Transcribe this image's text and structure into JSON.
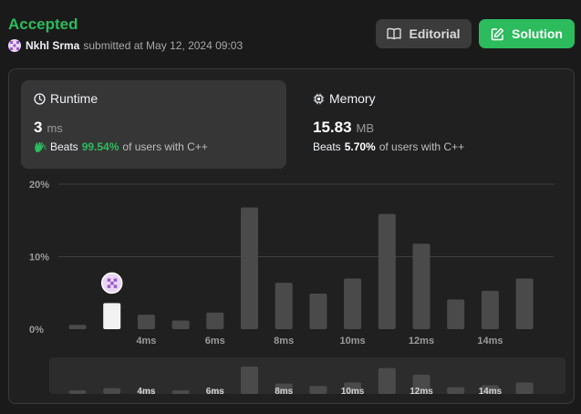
{
  "header": {
    "status": "Accepted",
    "user_name": "Nkhl Srma",
    "submitted_text": "submitted at May 12, 2024 09:03",
    "editorial_label": "Editorial",
    "solution_label": "Solution"
  },
  "runtime": {
    "title": "Runtime",
    "value": "3",
    "unit": "ms",
    "beats_label": "Beats",
    "beats_pct": "99.54%",
    "beats_suffix": "of users with C++"
  },
  "memory": {
    "title": "Memory",
    "value": "15.83",
    "unit": "MB",
    "beats_label": "Beats",
    "beats_pct": "5.70%",
    "beats_suffix": "of users with C++"
  },
  "colors": {
    "accepted": "#2cbb5d",
    "bar": "#4a4a4a",
    "bar_highlight": "#f2f2f2",
    "grid": "#3e3e3e"
  },
  "chart_data": {
    "type": "bar",
    "y_ticks": [
      "20%",
      "10%",
      "0%"
    ],
    "ylim": [
      0,
      20
    ],
    "x_tick_labels": [
      "4ms",
      "6ms",
      "8ms",
      "10ms",
      "12ms",
      "14ms"
    ],
    "values": [
      0.6,
      3.6,
      2.0,
      1.2,
      2.3,
      16.8,
      6.4,
      4.9,
      7.0,
      15.9,
      11.8,
      4.1,
      5.3,
      7.0
    ],
    "highlight_index": 1,
    "grid": true
  },
  "navigator_data": {
    "x_tick_labels": [
      "4ms",
      "6ms",
      "8ms",
      "10ms",
      "12ms",
      "14ms"
    ]
  }
}
